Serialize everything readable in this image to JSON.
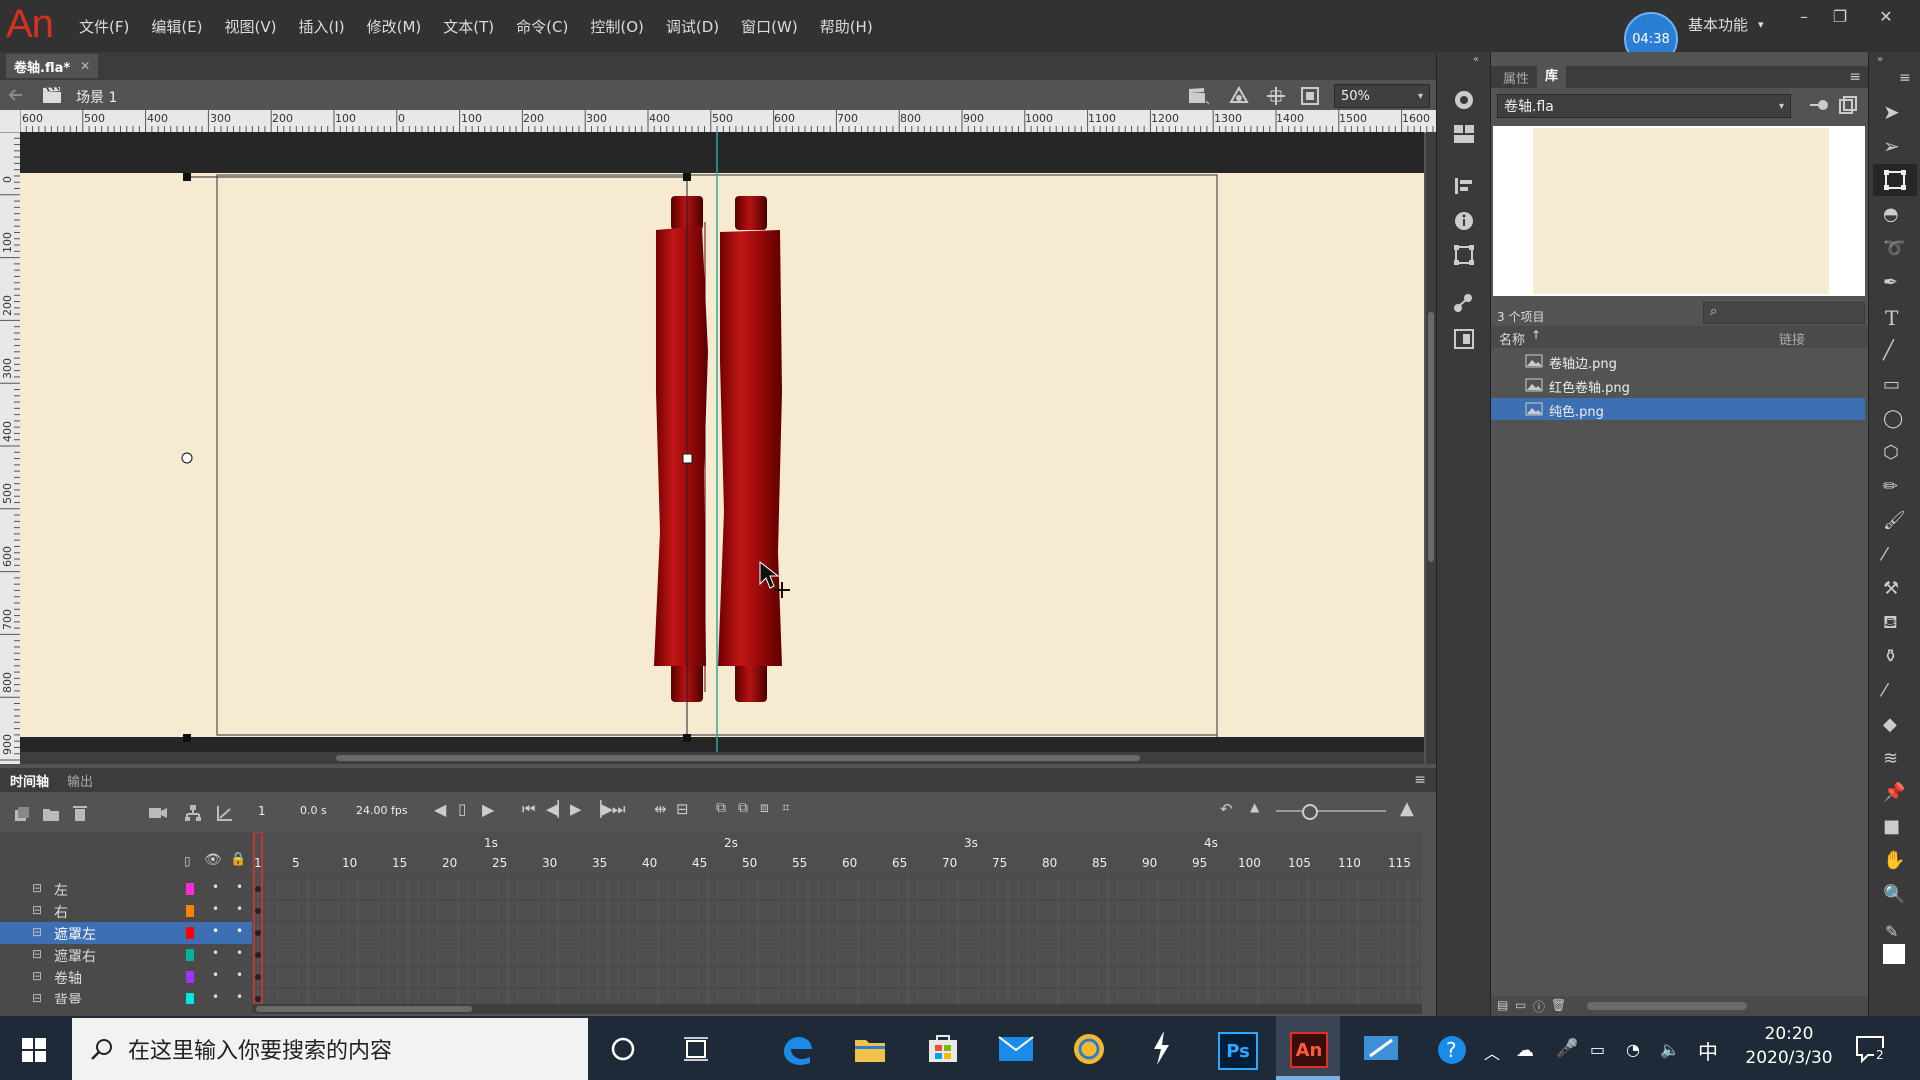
{
  "app": {
    "logo": "An",
    "menus": [
      "文件(F)",
      "编辑(E)",
      "视图(V)",
      "插入(I)",
      "修改(M)",
      "文本(T)",
      "命令(C)",
      "控制(O)",
      "调试(D)",
      "窗口(W)",
      "帮助(H)"
    ],
    "timer": "04:38",
    "workspace": "基本功能",
    "workspace_arrow": "▾",
    "win_minimize": "–",
    "win_restore": "❐",
    "win_close": "✕"
  },
  "document": {
    "tab_title": "卷轴.fla*",
    "tab_close": "✕",
    "scene": "场景 1",
    "zoom": "50%"
  },
  "ruler": {
    "h_labels": [
      "600",
      "500",
      "400",
      "300",
      "200",
      "100",
      "0",
      "100",
      "200",
      "300",
      "400",
      "500",
      "600",
      "700",
      "800",
      "900",
      "1000",
      "1100",
      "1200",
      "1300",
      "1400",
      "1500",
      "1600"
    ],
    "v_labels": [
      "0",
      "100",
      "200",
      "300",
      "400",
      "500",
      "600",
      "700",
      "800",
      "900"
    ]
  },
  "library": {
    "tab_properties": "属性",
    "tab_library": "库",
    "file_select": "卷轴.fla",
    "item_count": "3 个项目",
    "search_placeholder": "",
    "col_name": "名称",
    "col_linkage": "链接",
    "items": [
      "卷轴边.png",
      "红色卷轴.png",
      "纯色.png"
    ],
    "selected_index": 2
  },
  "timeline": {
    "tab_timeline": "时间轴",
    "tab_output": "输出",
    "current_frame": "1",
    "elapsed": "0.0 s",
    "fps": "24.00 fps",
    "second_labels": [
      "1s",
      "2s",
      "3s",
      "4s"
    ],
    "frame_labels": [
      "1",
      "5",
      "10",
      "15",
      "20",
      "25",
      "30",
      "35",
      "40",
      "45",
      "50",
      "55",
      "60",
      "65",
      "70",
      "75",
      "80",
      "85",
      "90",
      "95",
      "100",
      "105",
      "110",
      "115"
    ],
    "layers": [
      {
        "name": "左",
        "color": "#ff2bd6",
        "selected": false
      },
      {
        "name": "右",
        "color": "#ff7f00",
        "selected": false
      },
      {
        "name": "遮罩左",
        "color": "#ff0000",
        "selected": true
      },
      {
        "name": "遮罩右",
        "color": "#00b39b",
        "selected": false
      },
      {
        "name": "卷轴",
        "color": "#a032ff",
        "selected": false
      },
      {
        "name": "背景",
        "color": "#00e6e6",
        "selected": false
      }
    ]
  },
  "taskbar": {
    "search_placeholder": "在这里输入你要搜索的内容",
    "ime": "中",
    "time": "20:20",
    "date": "2020/3/30",
    "notification_count": "2",
    "ps_label": "Ps",
    "an_label": "An"
  },
  "colors": {
    "accent": "#2a7fd4",
    "stage": "#f6ead0",
    "scroll_red": "#a80d0d",
    "selection": "#3d6fb3"
  }
}
